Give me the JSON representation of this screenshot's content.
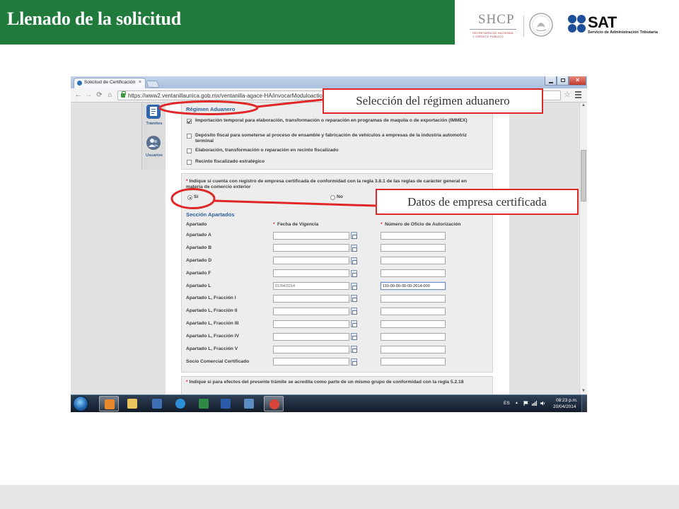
{
  "slide": {
    "title": "Llenado de la solicitud",
    "colors": {
      "title_bar": "#1f7a3b",
      "callout_red": "#e02828",
      "footer": "#e7e7e7"
    },
    "logos": {
      "shcp": "SHCP",
      "shcp_line1": "SECRETARÍA DE HACIENDA",
      "shcp_line2": "Y CRÉDITO PÚBLICO",
      "seal_icon": "mexico-seal-icon",
      "sat": "SAT",
      "sat_sub": "Servicio de Administración Tributaria"
    },
    "callouts": {
      "regimen": "Selección del régimen aduanero",
      "empresa": "Datos de empresa certificada"
    }
  },
  "browser": {
    "tab_title": "Solicitud de Certificación",
    "url": "https://www2.ventanillaunica.gob.mx/ventanilla-agace-HA/invocarModuloaction?list",
    "sidebar": [
      {
        "label": "Trámites",
        "icon": "document-icon"
      },
      {
        "label": "Usuarios",
        "icon": "users-icon"
      }
    ],
    "page": {
      "required_mark": "*",
      "regimen": {
        "title": "Régimen Aduanero",
        "options": [
          {
            "label": "Importación temporal para elaboración, transformación o reparación en programas de maquila o de exportación (IMMEX)",
            "checked": true
          },
          {
            "label": "Depósito fiscal para someterse al proceso de ensamble y fabricación de vehículos a empresas de la industria automotriz terminal",
            "checked": false
          },
          {
            "label": "Elaboración, transformación o reparación en recinto fiscalizado",
            "checked": false
          },
          {
            "label": "Recinto fiscalizado estratégico",
            "checked": false
          }
        ]
      },
      "empresa_certificada": {
        "question": "Indique si cuenta con registro de empresa certificada de conformidad con la regla 3.8.1 de las reglas de carácter general en materia de comercio exterior",
        "options": [
          {
            "label": "Sí",
            "selected": true
          },
          {
            "label": "No",
            "selected": false
          }
        ]
      },
      "apartados": {
        "title": "Sección Apartados",
        "columns": [
          "Apartado",
          "Fecha de Vigencia",
          "Número de Oficio de Autorización"
        ],
        "rows": [
          {
            "label": "Apartado A",
            "fecha": "",
            "numero": ""
          },
          {
            "label": "Apartado B",
            "fecha": "",
            "numero": ""
          },
          {
            "label": "Apartado D",
            "fecha": "",
            "numero": ""
          },
          {
            "label": "Apartado F",
            "fecha": "",
            "numero": ""
          },
          {
            "label": "Apartado L",
            "fecha": "01/04/2014",
            "numero": "110-00-00-00-00-2014-000",
            "focused": true
          },
          {
            "label": "Apartado L, Fracción I",
            "fecha": "",
            "numero": ""
          },
          {
            "label": "Apartado L, Fracción II",
            "fecha": "",
            "numero": ""
          },
          {
            "label": "Apartado L, Fracción III",
            "fecha": "",
            "numero": ""
          },
          {
            "label": "Apartado L, Fracción IV",
            "fecha": "",
            "numero": ""
          },
          {
            "label": "Apartado L, Fracción V",
            "fecha": "",
            "numero": ""
          },
          {
            "label": "Socio Comercial Certificado",
            "fecha": "",
            "numero": ""
          }
        ]
      },
      "grupo": {
        "question": "Indique si para efectos del presente trámite se acredita como parte de un mismo grupo de conformidad con la regla 5.2.18"
      }
    }
  },
  "taskbar": {
    "apps": [
      {
        "icon": "outlook-icon",
        "color": "#e8892b",
        "active": true
      },
      {
        "icon": "file-explorer-icon",
        "color": "#e9c45a",
        "active": false
      },
      {
        "icon": "application-icon",
        "color": "#3c6fb4",
        "active": false
      },
      {
        "icon": "internet-explorer-icon",
        "color": "#2c8fd8",
        "active": false
      },
      {
        "icon": "excel-icon",
        "color": "#2f8a46",
        "active": false
      },
      {
        "icon": "word-icon",
        "color": "#2b5aa8",
        "active": false
      },
      {
        "icon": "snipping-tool-icon",
        "color": "#5a8bc4",
        "active": false
      },
      {
        "icon": "chrome-icon",
        "color": "#d9443a",
        "active": true
      }
    ],
    "language": "ES",
    "time": "08:23 p.m.",
    "date": "20/04/2014"
  }
}
